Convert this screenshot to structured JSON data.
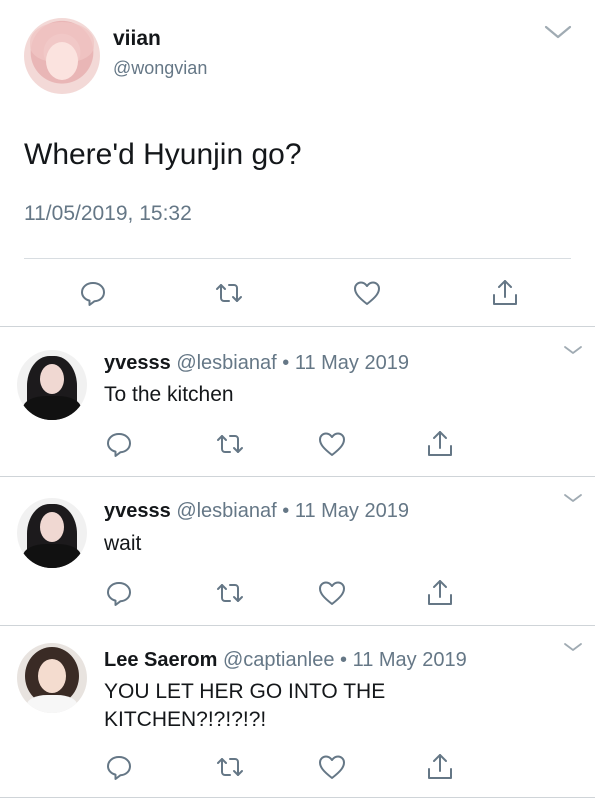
{
  "main_tweet": {
    "display_name": "viian",
    "handle": "@wongvian",
    "text": "Where'd Hyunjin go?",
    "timestamp": "11/05/2019, 15:32"
  },
  "replies": [
    {
      "display_name": "yvesss",
      "handle": "@lesbianaf",
      "separator": "•",
      "date": "11 May 2019",
      "text_lines": [
        "To the kitchen"
      ]
    },
    {
      "display_name": "yvesss",
      "handle": "@lesbianaf",
      "separator": "•",
      "date": "11 May 2019",
      "text_lines": [
        "wait"
      ]
    },
    {
      "display_name": "Lee Saerom",
      "handle": "@captianlee",
      "separator": "•",
      "date": "11 May 2019",
      "text_lines": [
        "YOU LET HER GO INTO THE",
        "KITCHEN?!?!?!?!"
      ]
    }
  ],
  "icons": {
    "reply": "reply-icon",
    "retweet": "retweet-icon",
    "like": "like-icon",
    "share": "share-icon",
    "more": "chevron-down-icon"
  },
  "colors": {
    "text": "#14171a",
    "secondary": "#657786",
    "divider": "#d8dde1"
  }
}
